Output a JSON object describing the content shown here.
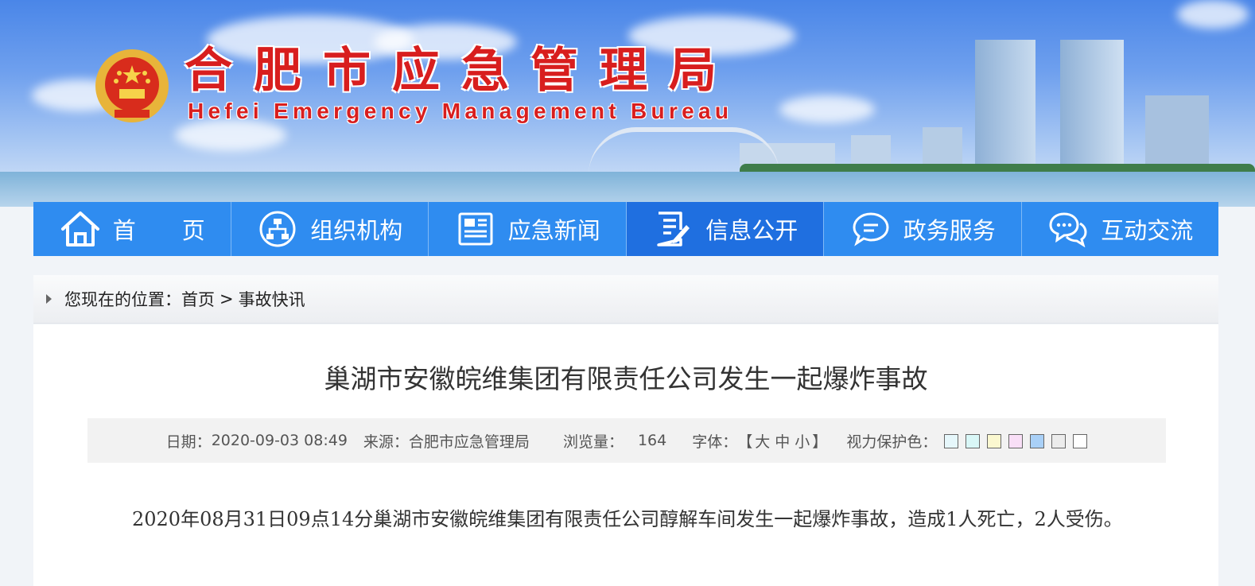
{
  "header": {
    "title": "合肥市应急管理局",
    "subtitle": "Hefei Emergency Management Bureau"
  },
  "nav": {
    "items": [
      {
        "label": "首　　页",
        "icon": "home-icon"
      },
      {
        "label": "组织机构",
        "icon": "org-chart-icon"
      },
      {
        "label": "应急新闻",
        "icon": "newspaper-icon"
      },
      {
        "label": "信息公开",
        "icon": "document-edit-icon"
      },
      {
        "label": "政务服务",
        "icon": "chat-bubble-icon"
      },
      {
        "label": "互动交流",
        "icon": "comments-icon"
      }
    ],
    "active_index": 3
  },
  "breadcrumb": {
    "prefix": "您现在的位置：",
    "home": "首页",
    "separator": ">",
    "current": "事故快讯"
  },
  "article": {
    "title": "巢湖市安徽皖维集团有限责任公司发生一起爆炸事故",
    "meta": {
      "date_label": "日期：",
      "date": "2020-09-03 08:49",
      "source_label": "来源：",
      "source": "合肥市应急管理局",
      "views_label": "浏览量：",
      "views": "164",
      "font_label": "字体：",
      "font_open": "【",
      "font_large": "大",
      "font_medium": "中",
      "font_small": "小",
      "font_close": "】",
      "eye_label": "视力保护色：",
      "eye_colors": [
        "#e6f7fb",
        "#d9f7f7",
        "#fbf8d0",
        "#f9dff7",
        "#a9d0f7",
        "#ececec",
        "#ffffff"
      ]
    },
    "body": "2020年08月31日09点14分巢湖市安徽皖维集团有限责任公司醇解车间发生一起爆炸事故，造成1人死亡，2人受伤。"
  },
  "colors": {
    "nav_bg": "#2f8cf0",
    "nav_active": "#1f6fe0",
    "title_red": "#d81e1e"
  }
}
